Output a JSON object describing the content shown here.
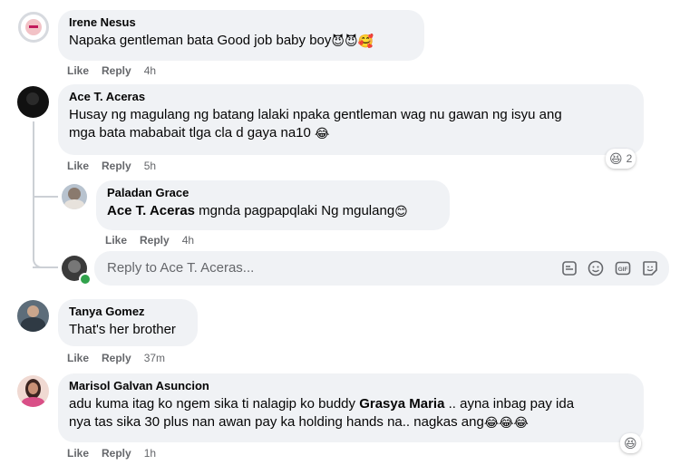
{
  "comments": [
    {
      "author": "Irene Nesus",
      "text": "Napaka gentleman bata Good job baby boy",
      "emojis": "😈😈🥰",
      "like": "Like",
      "reply": "Reply",
      "time": "4h"
    },
    {
      "author": "Ace T. Aceras",
      "text_line1": "Husay ng magulang ng batang lalaki npaka gentleman wag nu gawan ng isyu ang",
      "text_line2": "mga bata mababait tlga cla d gaya na10",
      "emojis": "😂",
      "like": "Like",
      "reply": "Reply",
      "time": "5h",
      "reaction_emoji": "😆",
      "reaction_count": "2",
      "replies": [
        {
          "author": "Paladan Grace",
          "mention": "Ace T. Aceras",
          "text": " mgnda pagpapqlaki Ng mgulang",
          "emojis": "😊",
          "like": "Like",
          "reply": "Reply",
          "time": "4h"
        }
      ],
      "reply_placeholder": "Reply to Ace T. Aceras..."
    },
    {
      "author": "Tanya Gomez",
      "text": "That's her brother",
      "like": "Like",
      "reply": "Reply",
      "time": "37m"
    },
    {
      "author": "Marisol Galvan Asuncion",
      "text_line1_a": "adu kuma itag ko ngem sika ti nalagip ko buddy ",
      "mention": "Grasya Maria",
      "text_line1_b": " .. ayna inbag pay ida",
      "text_line2": "nya tas sika 30 plus nan awan pay ka holding hands na.. nagkas ang",
      "emojis": "😂😂😂",
      "like": "Like",
      "reply": "Reply",
      "time": "1h",
      "reaction_emoji": "😆"
    }
  ],
  "icons": {
    "sticker": "sticker-icon",
    "emoji": "emoji-icon",
    "gif": "gif-icon",
    "avatar_sticker": "avatar-sticker-icon"
  },
  "colors": {
    "bubble": "#f0f2f5",
    "meta": "#65676b",
    "online": "#31a24c"
  }
}
